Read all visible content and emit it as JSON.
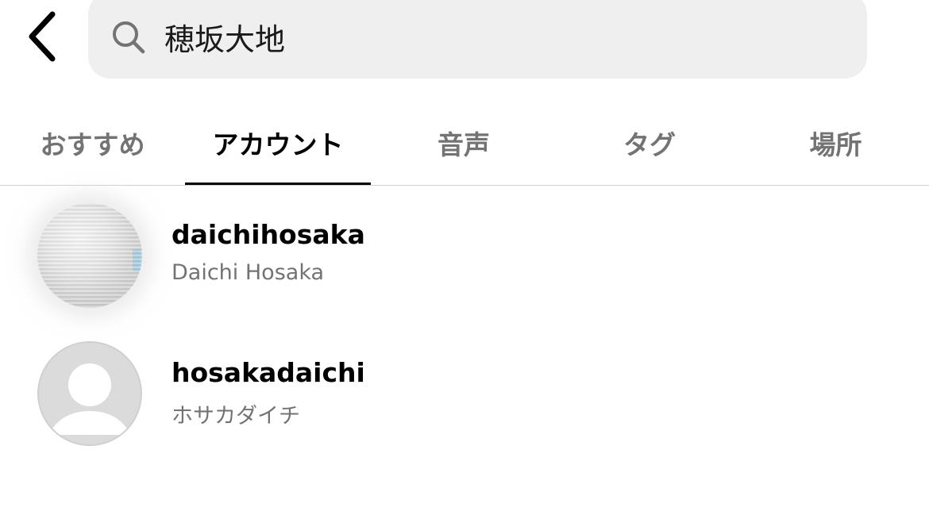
{
  "search": {
    "value": "穂坂大地",
    "placeholder": ""
  },
  "tabs": [
    {
      "label": "おすすめ",
      "active": false
    },
    {
      "label": "アカウント",
      "active": true
    },
    {
      "label": "音声",
      "active": false
    },
    {
      "label": "タグ",
      "active": false
    },
    {
      "label": "場所",
      "active": false
    }
  ],
  "results": [
    {
      "username": "daichihosaka",
      "full_name": "Daichi Hosaka",
      "avatar": "profile-photo"
    },
    {
      "username": "hosakadaichi",
      "full_name": "ホサカダイチ",
      "avatar": "default-avatar"
    }
  ],
  "icons": {
    "back": "chevron-left-icon",
    "search": "search-icon"
  },
  "colors": {
    "search_bg": "#efefef",
    "inactive_tab": "#737373",
    "active_tab": "#000000",
    "secondary_text": "#737373",
    "divider": "#d0d0d0"
  }
}
